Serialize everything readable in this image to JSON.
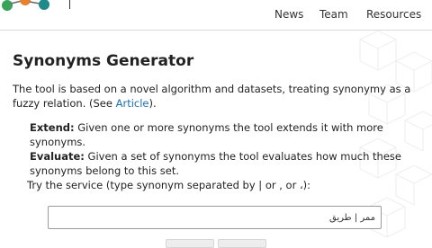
{
  "nav": {
    "items": [
      {
        "label": "News"
      },
      {
        "label": "Team"
      },
      {
        "label": "Resources"
      }
    ]
  },
  "main": {
    "title": "Synonyms Generator",
    "intro_text": "The tool is based on a novel algorithm and datasets, treating synonymy as a fuzzy relation. (See ",
    "intro_link": "Article",
    "intro_end": ").",
    "extend_label": "Extend:",
    "extend_text": " Given one or more synonyms the tool extends it with more synonyms.",
    "evaluate_label": "Evaluate:",
    "evaluate_text": " Given a set of synonyms the tool evaluates how much these synonyms belong to this set.",
    "try_text": "Try the service (type synonym separated by | or , or ،):",
    "input_value": "ممر | طريق"
  },
  "colors": {
    "logo_green": "#3aa35b",
    "logo_orange": "#e8812d",
    "logo_teal": "#1f8a8a",
    "link": "#1a6fb3"
  }
}
